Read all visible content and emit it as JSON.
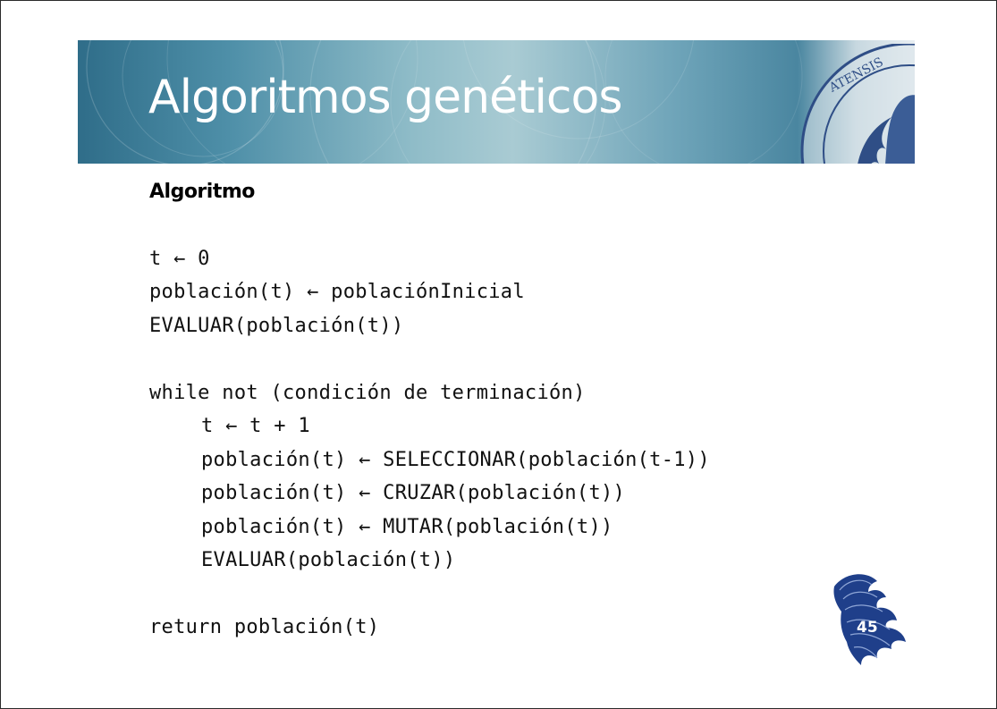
{
  "slide": {
    "title": "Algoritmos genéticos",
    "section_heading": "Algoritmo",
    "seal_text": "ATENSIS",
    "code": [
      "t ← 0",
      "población(t) ← poblaciónInicial",
      "EVALUAR(población(t))",
      "while not (condición de terminación)",
      "t ← t + 1",
      "población(t) ← SELECCIONAR(población(t-1))",
      "población(t) ← CRUZAR(población(t))",
      "población(t) ← MUTAR(población(t))",
      "EVALUAR(población(t))",
      "return población(t)"
    ],
    "page_number": "45"
  },
  "colors": {
    "banner_dark": "#2f6d89",
    "banner_light": "#a9cbd3",
    "seal_blue": "#2f4e86",
    "logo_blue": "#1f3f8a"
  }
}
